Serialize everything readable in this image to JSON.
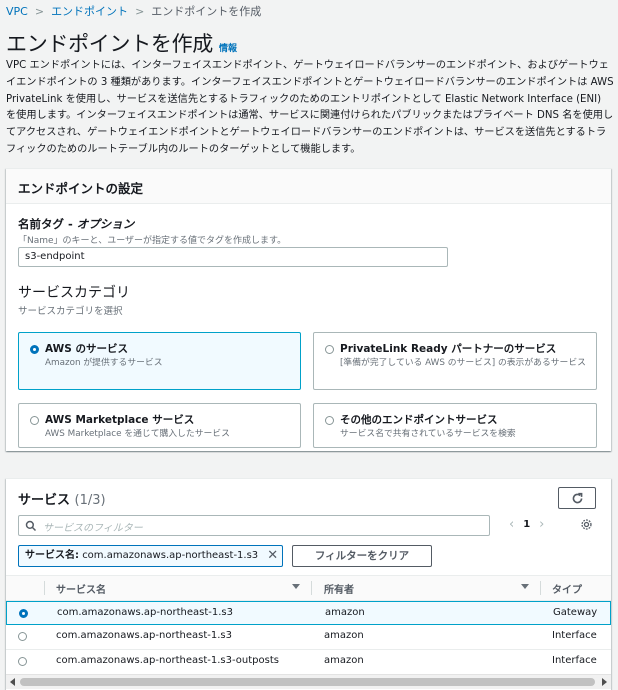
{
  "breadcrumb": {
    "items": [
      "VPC",
      "エンドポイント",
      "エンドポイントを作成"
    ]
  },
  "header": {
    "title": "エンドポイントを作成",
    "info": "情報",
    "description": "VPC エンドポイントには、インターフェイスエンドポイント、ゲートウェイロードバランサーのエンドポイント、およびゲートウェイエンドポイントの 3 種類があります。インターフェイスエンドポイントとゲートウェイロードバランサーのエンドポイントは AWS PrivateLink を使用し、サービスを送信先とするトラフィックのためのエントリポイントとして Elastic Network Interface (ENI) を使用します。インターフェイスエンドポイントは通常、サービスに関連付けられたパブリックまたはプライベート DNS 名を使用してアクセスされ、ゲートウェイエンドポイントとゲートウェイロードバランサーのエンドポイントは、サービスを送信先とするトラフィックのためのルートテーブル内のルートのターゲットとして機能します。"
  },
  "settings": {
    "title": "エンドポイントの設定",
    "name_tag": {
      "label": "名前タグ - ",
      "label_optional": "オプション",
      "description": "「Name」のキーと、ユーザーが指定する値でタグを作成します。",
      "value": "s3-endpoint"
    },
    "category": {
      "heading": "サービスカテゴリ",
      "description": "サービスカテゴリを選択",
      "options": [
        {
          "title": "AWS のサービス",
          "desc": "Amazon が提供するサービス",
          "selected": true
        },
        {
          "title": "PrivateLink Ready パートナーのサービス",
          "desc": "[準備が完了している AWS のサービス] の表示があるサービス",
          "selected": false
        },
        {
          "title": "AWS Marketplace サービス",
          "desc": "AWS Marketplace を通じて購入したサービス",
          "selected": false
        },
        {
          "title": "その他のエンドポイントサービス",
          "desc": "サービス名で共有されているサービスを検索",
          "selected": false
        }
      ]
    }
  },
  "services": {
    "title": "サービス",
    "count": "(1/3)",
    "search_placeholder": "サービスのフィルター",
    "page": "1",
    "filter_token": {
      "key": "サービス名:",
      "value": "com.amazonaws.ap-northeast-1.s3"
    },
    "clear_filter": "フィルターをクリア",
    "columns": [
      "サービス名",
      "所有者",
      "タイプ"
    ],
    "rows": [
      {
        "name": "com.amazonaws.ap-northeast-1.s3",
        "owner": "amazon",
        "type": "Gateway",
        "selected": true
      },
      {
        "name": "com.amazonaws.ap-northeast-1.s3",
        "owner": "amazon",
        "type": "Interface",
        "selected": false
      },
      {
        "name": "com.amazonaws.ap-northeast-1.s3-outposts",
        "owner": "amazon",
        "type": "Interface",
        "selected": false
      }
    ]
  }
}
